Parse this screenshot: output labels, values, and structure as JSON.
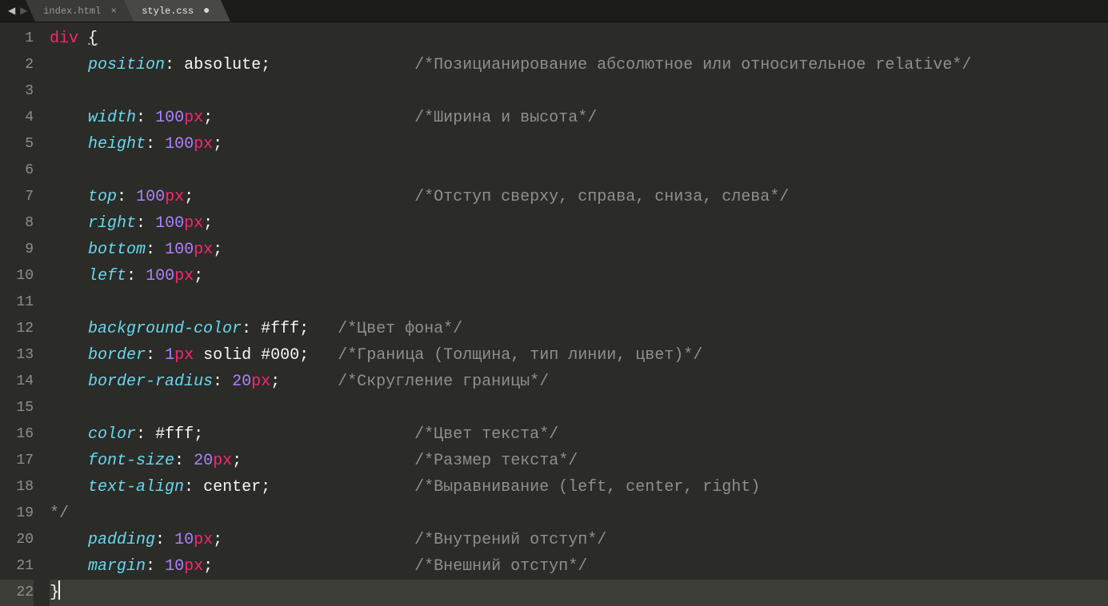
{
  "tabs": [
    {
      "label": "index.html",
      "active": false,
      "dirty": false
    },
    {
      "label": "style.css",
      "active": true,
      "dirty": true
    }
  ],
  "editor": {
    "current_line": 22,
    "lines": [
      {
        "num": 1,
        "indent": 0,
        "tokens": [
          {
            "t": "tag",
            "v": "div"
          },
          {
            "t": "space",
            "v": " "
          },
          {
            "t": "brace",
            "v": "{",
            "underline": true
          }
        ]
      },
      {
        "num": 2,
        "indent": 1,
        "prop": "position",
        "value_tokens": [
          {
            "t": "valword",
            "v": "absolute"
          }
        ],
        "comment": "/*Позицианирование абсолютное или относительное relative*/",
        "comment_col": 38
      },
      {
        "num": 3,
        "blank": true
      },
      {
        "num": 4,
        "indent": 1,
        "prop": "width",
        "value_tokens": [
          {
            "t": "num",
            "v": "100"
          },
          {
            "t": "unit",
            "v": "px"
          }
        ],
        "comment": "/*Ширина и высота*/",
        "comment_col": 38
      },
      {
        "num": 5,
        "indent": 1,
        "prop": "height",
        "value_tokens": [
          {
            "t": "num",
            "v": "100"
          },
          {
            "t": "unit",
            "v": "px"
          }
        ]
      },
      {
        "num": 6,
        "blank": true
      },
      {
        "num": 7,
        "indent": 1,
        "prop": "top",
        "value_tokens": [
          {
            "t": "num",
            "v": "100"
          },
          {
            "t": "unit",
            "v": "px"
          }
        ],
        "comment": "/*Отступ сверху, справа, сниза, слева*/",
        "comment_col": 38
      },
      {
        "num": 8,
        "indent": 1,
        "prop": "right",
        "value_tokens": [
          {
            "t": "num",
            "v": "100"
          },
          {
            "t": "unit",
            "v": "px"
          }
        ]
      },
      {
        "num": 9,
        "indent": 1,
        "prop": "bottom",
        "value_tokens": [
          {
            "t": "num",
            "v": "100"
          },
          {
            "t": "unit",
            "v": "px"
          }
        ]
      },
      {
        "num": 10,
        "indent": 1,
        "prop": "left",
        "value_tokens": [
          {
            "t": "num",
            "v": "100"
          },
          {
            "t": "unit",
            "v": "px"
          }
        ]
      },
      {
        "num": 11,
        "blank": true
      },
      {
        "num": 12,
        "indent": 1,
        "prop": "background-color",
        "value_tokens": [
          {
            "t": "hex",
            "v": "#fff"
          }
        ],
        "comment": "/*Цвет фона*/",
        "comment_col": 30
      },
      {
        "num": 13,
        "indent": 1,
        "prop": "border",
        "value_tokens": [
          {
            "t": "num",
            "v": "1"
          },
          {
            "t": "unit",
            "v": "px"
          },
          {
            "t": "space",
            "v": " "
          },
          {
            "t": "valword",
            "v": "solid"
          },
          {
            "t": "space",
            "v": " "
          },
          {
            "t": "hex",
            "v": "#000"
          }
        ],
        "comment": "/*Граница (Толщина, тип линии, цвет)*/",
        "comment_col": 30
      },
      {
        "num": 14,
        "indent": 1,
        "prop": "border-radius",
        "value_tokens": [
          {
            "t": "num",
            "v": "20"
          },
          {
            "t": "unit",
            "v": "px"
          }
        ],
        "comment": "/*Скругление границы*/",
        "comment_col": 30
      },
      {
        "num": 15,
        "blank": true
      },
      {
        "num": 16,
        "indent": 1,
        "prop": "color",
        "value_tokens": [
          {
            "t": "hex",
            "v": "#fff"
          }
        ],
        "comment": "/*Цвет текста*/",
        "comment_col": 38
      },
      {
        "num": 17,
        "indent": 1,
        "prop": "font-size",
        "value_tokens": [
          {
            "t": "num",
            "v": "20"
          },
          {
            "t": "unit",
            "v": "px"
          }
        ],
        "comment": "/*Размер текста*/",
        "comment_col": 38
      },
      {
        "num": 18,
        "indent": 1,
        "prop": "text-align",
        "value_tokens": [
          {
            "t": "valword",
            "v": "center"
          }
        ],
        "comment": "/*Выравнивание (left, center, right)",
        "comment_col": 38
      },
      {
        "num": 19,
        "raw_comment": "*/"
      },
      {
        "num": 20,
        "indent": 1,
        "prop": "padding",
        "value_tokens": [
          {
            "t": "num",
            "v": "10"
          },
          {
            "t": "unit",
            "v": "px"
          }
        ],
        "comment": "/*Внутрений отступ*/",
        "comment_col": 38
      },
      {
        "num": 21,
        "indent": 1,
        "prop": "margin",
        "value_tokens": [
          {
            "t": "num",
            "v": "10"
          },
          {
            "t": "unit",
            "v": "px"
          }
        ],
        "comment": "/*Внешний отступ*/",
        "comment_col": 38
      },
      {
        "num": 22,
        "indent": 0,
        "tokens": [
          {
            "t": "brace",
            "v": "}"
          }
        ],
        "cursor_after": true
      }
    ]
  }
}
